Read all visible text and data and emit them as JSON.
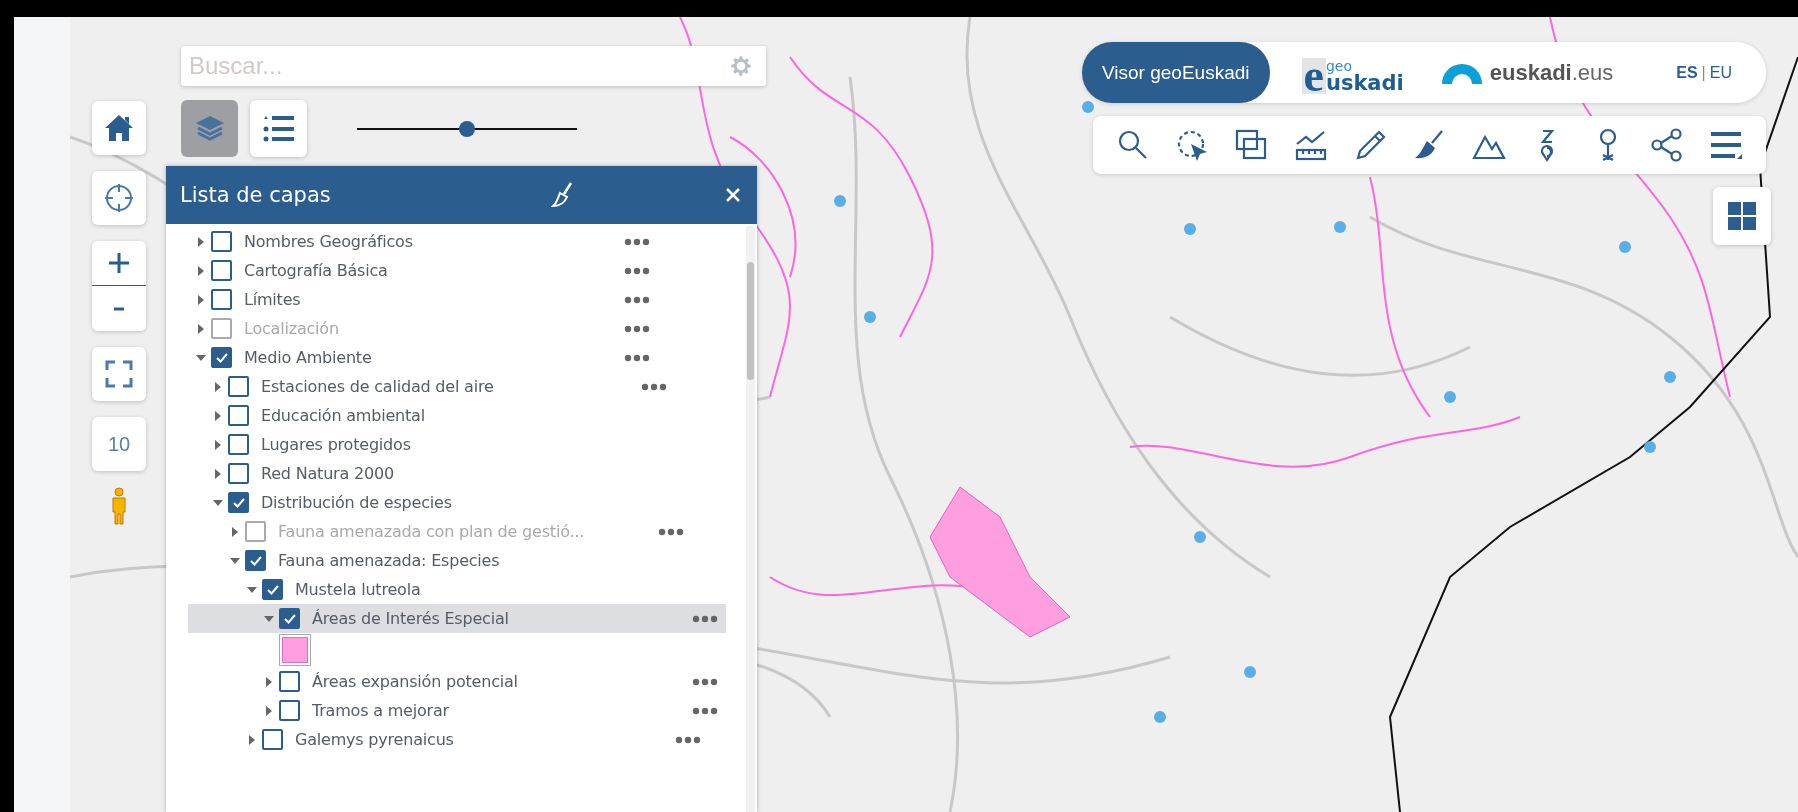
{
  "search": {
    "placeholder": "Buscar..."
  },
  "map_tools": [
    {
      "kind": "layers",
      "selected": true
    },
    {
      "kind": "legend",
      "selected": false
    }
  ],
  "opacity_slider": {
    "level": 0.5
  },
  "zoom_level": "10",
  "layer_panel": {
    "title": "Lista de capas",
    "layers": [
      {
        "label": "Nombres Geográficos",
        "checked": false,
        "expanded": false,
        "disabled": false,
        "selected": false,
        "has_menu": true
      },
      {
        "label": "Cartografía Básica",
        "checked": false,
        "expanded": false,
        "disabled": false,
        "selected": false,
        "has_menu": true
      },
      {
        "label": "Límites",
        "checked": false,
        "expanded": false,
        "disabled": false,
        "selected": false,
        "has_menu": true
      },
      {
        "label": "Localización",
        "checked": false,
        "expanded": false,
        "disabled": true,
        "selected": false,
        "has_menu": true
      },
      {
        "label": "Medio Ambiente",
        "checked": true,
        "expanded": true,
        "disabled": false,
        "selected": false,
        "has_menu": true,
        "children": [
          {
            "label": "Estaciones de calidad del aire",
            "checked": false,
            "expanded": false,
            "disabled": false,
            "selected": false,
            "has_menu": true
          },
          {
            "label": "Educación ambiental",
            "checked": false,
            "expanded": false,
            "disabled": false,
            "selected": false,
            "has_menu": false
          },
          {
            "label": "Lugares protegidos",
            "checked": false,
            "expanded": false,
            "disabled": false,
            "selected": false,
            "has_menu": false
          },
          {
            "label": "Red Natura 2000",
            "checked": false,
            "expanded": false,
            "disabled": false,
            "selected": false,
            "has_menu": false
          },
          {
            "label": "Distribución de especies",
            "checked": true,
            "expanded": true,
            "disabled": false,
            "selected": false,
            "has_menu": false,
            "children": [
              {
                "label": "Fauna amenazada con plan de gestió...",
                "checked": false,
                "expanded": false,
                "disabled": true,
                "selected": false,
                "has_menu": true
              },
              {
                "label": "Fauna amenazada: Especies",
                "checked": true,
                "expanded": true,
                "disabled": false,
                "selected": false,
                "has_menu": false,
                "children": [
                  {
                    "label": "Mustela lutreola",
                    "checked": true,
                    "expanded": true,
                    "disabled": false,
                    "selected": false,
                    "has_menu": false,
                    "children": [
                      {
                        "label": "Áreas de Interés Especial",
                        "checked": true,
                        "expanded": true,
                        "disabled": false,
                        "selected": true,
                        "has_menu": true,
                        "color": "#ff9fe0"
                      },
                      {
                        "label": "Áreas expansión potencial",
                        "checked": false,
                        "expanded": false,
                        "disabled": false,
                        "selected": false,
                        "has_menu": true
                      },
                      {
                        "label": "Tramos a mejorar",
                        "checked": false,
                        "expanded": false,
                        "disabled": false,
                        "selected": false,
                        "has_menu": true
                      }
                    ]
                  },
                  {
                    "label": "Galemys pyrenaicus",
                    "checked": false,
                    "expanded": false,
                    "disabled": false,
                    "selected": false,
                    "has_menu": true
                  }
                ]
              }
            ]
          }
        ]
      }
    ]
  },
  "header": {
    "app_button": "Visor geoEuskadi",
    "geo_logo": {
      "mark": "e",
      "top": "geo",
      "main": "uskadi"
    },
    "euskadi_logo": {
      "name": "euskadi",
      "suffix": ".eus"
    },
    "languages": [
      {
        "code": "ES",
        "selected": true
      },
      {
        "code": "EU",
        "selected": false
      }
    ],
    "separator": "|"
  }
}
